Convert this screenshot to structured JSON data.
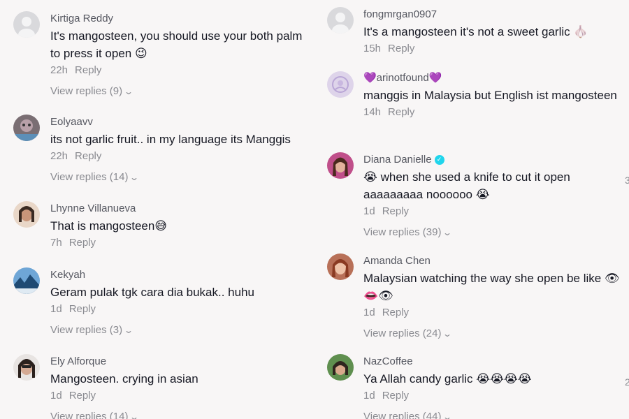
{
  "left": [
    {
      "name": "Kirtiga Reddy",
      "text": "It's mangosteen, you should use your both palm to press it open 😉",
      "time": "22h",
      "reply": "Reply",
      "replies": "View replies (9)"
    },
    {
      "name": "Eolyaavv",
      "text": "its not garlic fruit.. in my language its Manggis",
      "time": "22h",
      "reply": "Reply",
      "replies": "View replies (14)"
    },
    {
      "name": "Lhynne Villanueva",
      "text": "That is mangosteen😅",
      "time": "7h",
      "reply": "Reply"
    },
    {
      "name": "Kekyah",
      "text": "Geram pulak tgk cara dia bukak.. huhu",
      "time": "1d",
      "reply": "Reply",
      "replies": "View replies (3)"
    },
    {
      "name": "Ely Alforque",
      "text": "Mangosteen. crying in asian",
      "time": "1d",
      "reply": "Reply",
      "replies": "View replies (14)"
    }
  ],
  "right": [
    {
      "name": "fongmrgan0907",
      "text": "It's a mangosteen it's not a sweet garlic 🧄",
      "time": "15h",
      "reply": "Reply"
    },
    {
      "name": "💜arinotfound💜",
      "text": "manggis in Malaysia but English ist mangosteen",
      "time": "14h",
      "reply": "Reply"
    },
    {
      "name": "Diana Danielle",
      "text": "😭 when she used a knife to cut it open aaaaaaaaa noooooo 😭",
      "time": "1d",
      "reply": "Reply",
      "replies": "View replies (39)",
      "likes": "3"
    },
    {
      "name": "Amanda Chen",
      "text": "Malaysian watching the way she open be like 👁👄👁",
      "time": "1d",
      "reply": "Reply",
      "replies": "View replies (24)"
    },
    {
      "name": "NazCoffee",
      "text": "Ya Allah candy garlic 😭😭😭😭",
      "time": "1d",
      "reply": "Reply",
      "replies": "View replies (44)",
      "likes": "2"
    }
  ],
  "colors": {
    "name": "#555760",
    "text": "#161823",
    "meta": "#8a8b91",
    "verified": "#20d5ec"
  },
  "icons": {
    "chevron": "chevron-down-icon",
    "verified": "verified-badge-icon"
  }
}
